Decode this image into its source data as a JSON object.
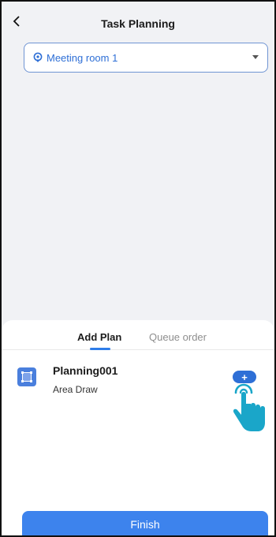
{
  "header": {
    "title": "Task Planning",
    "back_icon": "chevron-left-icon"
  },
  "room_select": {
    "value": "Meeting room 1",
    "icon": "location-pin-icon",
    "caret_icon": "caret-down-icon"
  },
  "tabs": [
    {
      "label": "Add Plan",
      "active": true
    },
    {
      "label": "Queue order",
      "active": false
    }
  ],
  "plans": [
    {
      "name": "Planning001",
      "type": "Area Draw",
      "icon": "area-draw-icon"
    }
  ],
  "add_button": {
    "label": "+",
    "icon": "plus-icon"
  },
  "pointer": {
    "icon": "hand-pointer-icon"
  },
  "footer": {
    "finish_label": "Finish"
  },
  "colors": {
    "accent": "#3d83ed",
    "map_bg": "#f1f2f5",
    "select_text": "#2e6fd6",
    "hand": "#1aa6c9"
  }
}
